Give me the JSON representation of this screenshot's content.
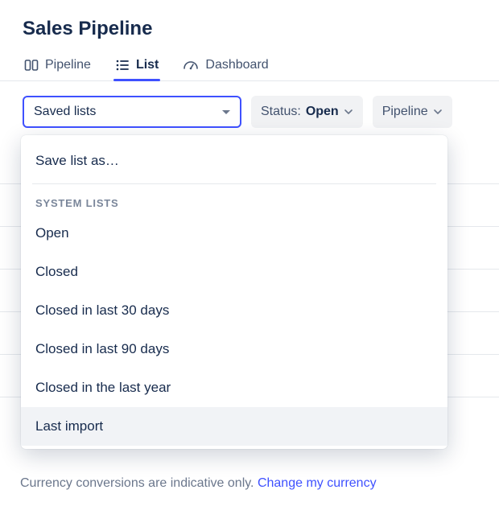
{
  "title": "Sales Pipeline",
  "tabs": {
    "pipeline": "Pipeline",
    "list": "List",
    "dashboard": "Dashboard"
  },
  "saved_lists": {
    "trigger_label": "Saved lists",
    "save_as": "Save list as…",
    "section_label": "SYSTEM LISTS",
    "items": [
      "Open",
      "Closed",
      "Closed in last 30 days",
      "Closed in last 90 days",
      "Closed in the last year",
      "Last import"
    ]
  },
  "filters": {
    "status_label": "Status:",
    "status_value": "Open",
    "pipeline_label": "Pipeline"
  },
  "footer": {
    "note": "Currency conversions are indicative only.",
    "link": "Change my currency"
  }
}
